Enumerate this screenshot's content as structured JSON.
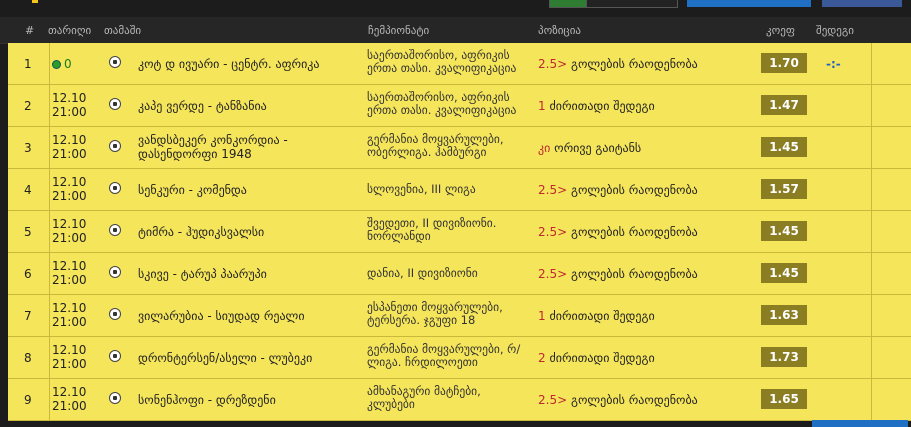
{
  "colors": {
    "row_bg": "#f5e55a",
    "odd_bg": "#8a7d22",
    "header_bg": "#262626",
    "highlight": "#c0282e",
    "result": "#1f5fc5",
    "live": "#2a9d2a"
  },
  "header": {
    "num": "#",
    "date": "თარიღი",
    "game": "თამაში",
    "championship": "ჩემპიონატი",
    "position": "პოზიცია",
    "odd": "კოეფ",
    "result": "შედეგი"
  },
  "rows": [
    {
      "num": "1",
      "live": "0",
      "date": "",
      "time": "",
      "game": "კოტ დ ივუარი - ცენტრ. აფრიკა",
      "championship": "საერთაშორისო, აფრიკის ერთა თასი. კვალიფიკაცია",
      "pos_highlight": "2.5>",
      "pos_text": "გოლების რაოდენობა",
      "odd": "1.70",
      "result": "-:-"
    },
    {
      "num": "2",
      "live": "",
      "date": "12.10",
      "time": "21:00",
      "game": "კაპე ვერდე - ტანზანია",
      "championship": "საერთაშორისო, აფრიკის ერთა თასი. კვალიფიკაცია",
      "pos_highlight": "1",
      "pos_text": "ძირითადი შედეგი",
      "odd": "1.47",
      "result": ""
    },
    {
      "num": "3",
      "live": "",
      "date": "12.10",
      "time": "21:00",
      "game": "ვანდსბეკერ კონკორდია - დასენდორფი 1948",
      "championship": "გერმანია მოყვარულები, ობერლიგა. ჰამბურგი",
      "pos_highlight": "კი",
      "pos_text": "ორივე გაიტანს",
      "odd": "1.45",
      "result": ""
    },
    {
      "num": "4",
      "live": "",
      "date": "12.10",
      "time": "21:00",
      "game": "სენკური - კომენდა",
      "championship": "სლოვენია, III ლიგა",
      "pos_highlight": "2.5>",
      "pos_text": "გოლების რაოდენობა",
      "odd": "1.57",
      "result": ""
    },
    {
      "num": "5",
      "live": "",
      "date": "12.10",
      "time": "21:00",
      "game": "ტიმრა - ჰუდიკსვალსი",
      "championship": "შვედეთი, II დივიზიონი. ნორლანდი",
      "pos_highlight": "2.5>",
      "pos_text": "გოლების რაოდენობა",
      "odd": "1.45",
      "result": ""
    },
    {
      "num": "6",
      "live": "",
      "date": "12.10",
      "time": "21:00",
      "game": "სკივე - ტარუპ პაარუპი",
      "championship": "დანია, II დივიზიონი",
      "pos_highlight": "2.5>",
      "pos_text": "გოლების რაოდენობა",
      "odd": "1.45",
      "result": ""
    },
    {
      "num": "7",
      "live": "",
      "date": "12.10",
      "time": "21:00",
      "game": "ვილარუბია - სიუდად რეალი",
      "championship": "ესპანეთი მოყვარულები, ტერსერა. ჯგუფი 18",
      "pos_highlight": "1",
      "pos_text": "ძირითადი შედეგი",
      "odd": "1.63",
      "result": ""
    },
    {
      "num": "8",
      "live": "",
      "date": "12.10",
      "time": "21:00",
      "game": "დრონტერსენ/ასელი - ლუბეკი",
      "championship": "გერმანია მოყვარულები, რ/ლიგა. ჩრდილოეთი",
      "pos_highlight": "2",
      "pos_text": "ძირითადი შედეგი",
      "odd": "1.73",
      "result": ""
    },
    {
      "num": "9",
      "live": "",
      "date": "12.10",
      "time": "21:00",
      "game": "სონენჰოფი - დრეზდენი",
      "championship": "ამხანაგური მატჩები, კლუბები",
      "pos_highlight": "2.5>",
      "pos_text": "გოლების რაოდენობა",
      "odd": "1.65",
      "result": ""
    }
  ]
}
